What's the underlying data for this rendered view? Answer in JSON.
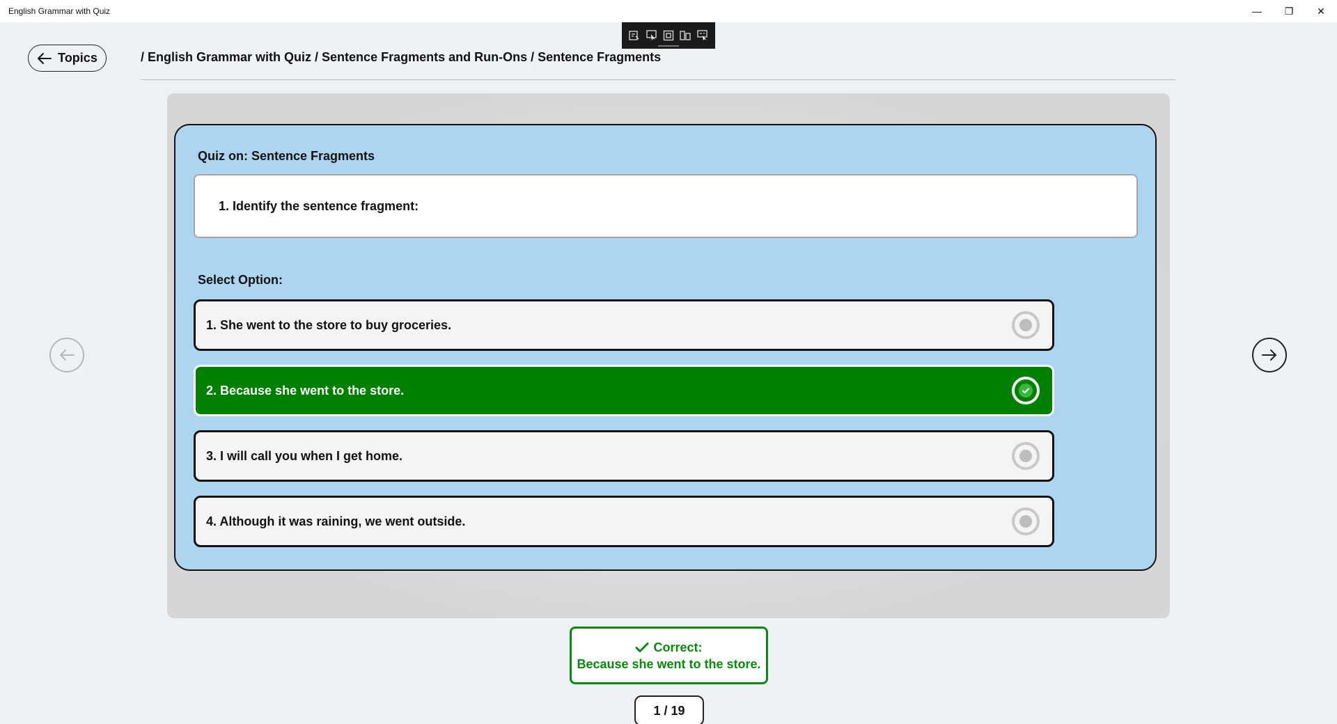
{
  "window": {
    "title": "English Grammar with Quiz",
    "minimize_glyph": "—",
    "maximize_glyph": "❐",
    "close_glyph": "✕"
  },
  "header": {
    "back_label": "Topics",
    "breadcrumb": "/ English Grammar with Quiz / Sentence Fragments and Run-Ons / Sentence Fragments"
  },
  "quiz": {
    "title": "Quiz on: Sentence Fragments",
    "question": "1.  Identify the sentence fragment:",
    "select_label": "Select Option:",
    "options": [
      {
        "label": "1. She went to the store to buy groceries.",
        "selected": false
      },
      {
        "label": "2. Because she went to the store.",
        "selected": true
      },
      {
        "label": "3. I will call you when I get home.",
        "selected": false
      },
      {
        "label": "4. Although it was raining, we went outside.",
        "selected": false
      }
    ]
  },
  "feedback": {
    "status": "Correct:",
    "answer": "Because she went to the store.",
    "icon": "checkmark-icon"
  },
  "pagination": {
    "counter": "1 / 19"
  },
  "colors": {
    "card_bg": "#aed5ef",
    "selected_bg": "#008000",
    "correct_text": "#0a8a0a",
    "page_bg": "#eef2f6"
  }
}
